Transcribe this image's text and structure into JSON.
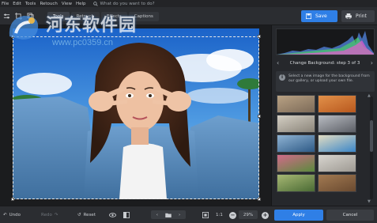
{
  "menu": {
    "items": [
      "File",
      "Edit",
      "Tools",
      "Retouch",
      "View",
      "Help"
    ],
    "search_placeholder": "What do you want to do?"
  },
  "toolbar": {
    "tabs": [
      "Tools",
      "Retouch",
      "Effects",
      "Captions"
    ],
    "save_label": "Save",
    "print_label": "Print"
  },
  "panel": {
    "step_title": "Change Background: step 3 of 3",
    "info_text": "Select a new image for the background from our gallery, or upload your own file.",
    "thumbnails": [
      {
        "name": "street-scene",
        "colors": [
          "#7c6a58",
          "#b9a284"
        ]
      },
      {
        "name": "autumn-alley",
        "colors": [
          "#b8581e",
          "#e2914a"
        ]
      },
      {
        "name": "cafe-interior",
        "colors": [
          "#8a8479",
          "#d4cfc4"
        ]
      },
      {
        "name": "city-buildings",
        "colors": [
          "#5c5f66",
          "#b9bcc2"
        ]
      },
      {
        "name": "lake-mountains",
        "colors": [
          "#2e5a86",
          "#8fb3d3"
        ]
      },
      {
        "name": "tropical-beach",
        "colors": [
          "#3a86c8",
          "#e2dcc2"
        ]
      },
      {
        "name": "flower-field",
        "colors": [
          "#5a8a3c",
          "#d26a8a"
        ]
      },
      {
        "name": "stone-texture",
        "colors": [
          "#9e9a93",
          "#d8d5cf"
        ]
      },
      {
        "name": "forest-path",
        "colors": [
          "#4a6a34",
          "#a7b874"
        ]
      },
      {
        "name": "wood-floor",
        "colors": [
          "#6a4a30",
          "#a27a52"
        ]
      }
    ]
  },
  "bottom": {
    "undo_label": "Undo",
    "redo_label": "Redo",
    "reset_label": "Reset",
    "zoom_ratio": "1:1",
    "zoom_percent": "29%",
    "apply_label": "Apply",
    "cancel_label": "Cancel"
  },
  "watermark": {
    "title": "河东软件园",
    "url": "www.pc0359.cn"
  }
}
